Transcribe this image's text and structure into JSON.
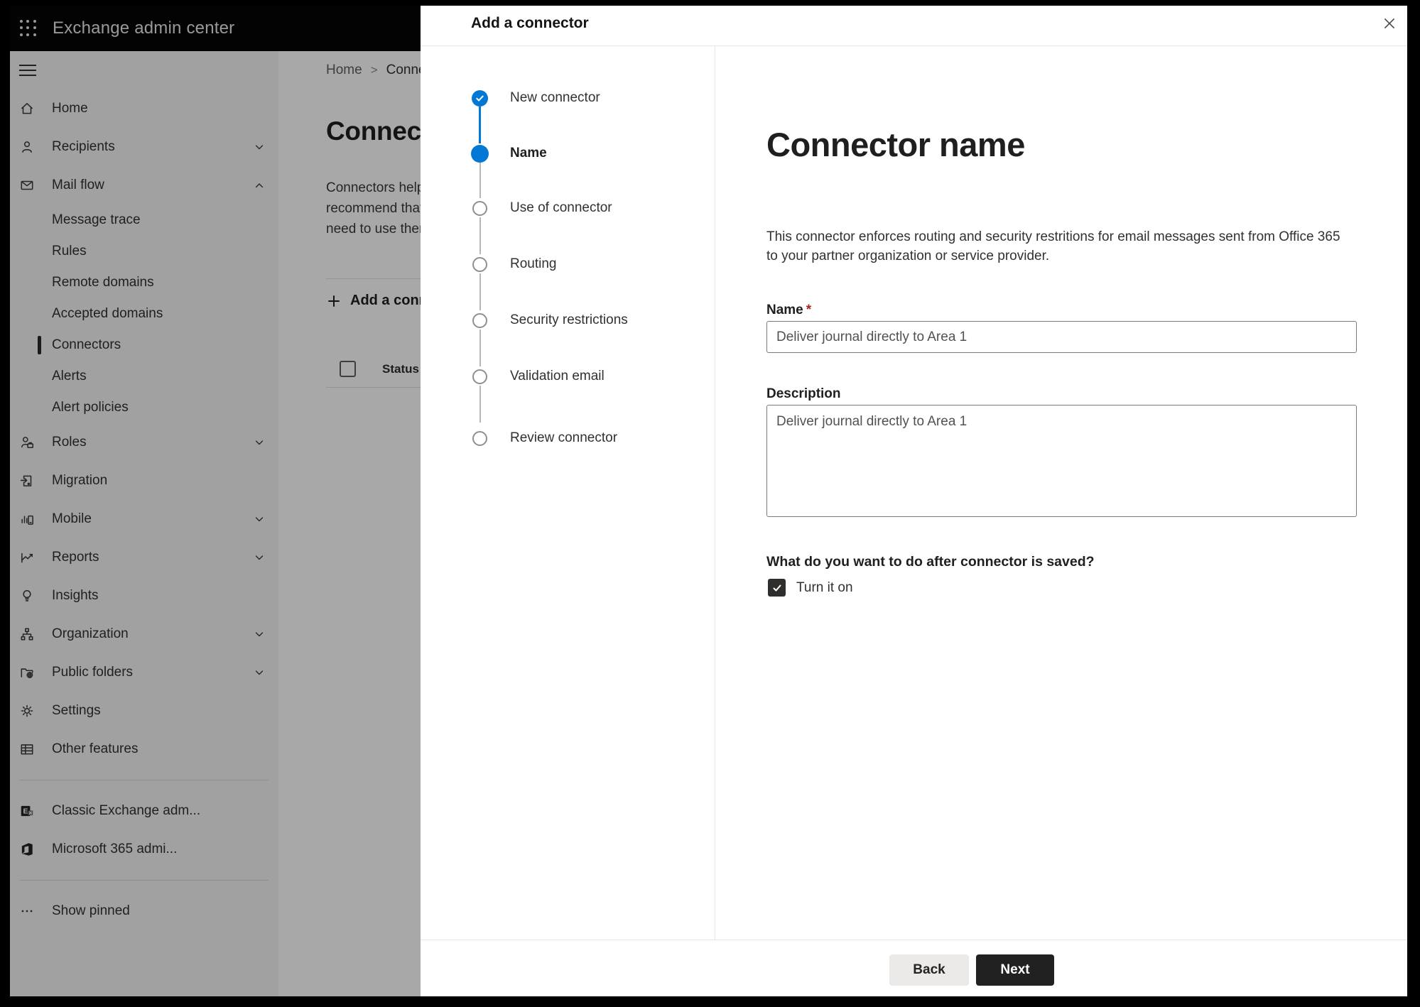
{
  "topbar": {
    "title": "Exchange admin center"
  },
  "sidebar": {
    "items": [
      {
        "label": "Home",
        "icon": "home"
      },
      {
        "label": "Recipients",
        "icon": "person",
        "chevron": "down"
      },
      {
        "label": "Mail flow",
        "icon": "mail",
        "chevron": "up",
        "expanded": true
      },
      {
        "label": "Message trace",
        "type": "sub"
      },
      {
        "label": "Rules",
        "type": "sub"
      },
      {
        "label": "Remote domains",
        "type": "sub"
      },
      {
        "label": "Accepted domains",
        "type": "sub"
      },
      {
        "label": "Connectors",
        "type": "sub",
        "selected": true
      },
      {
        "label": "Alerts",
        "type": "sub"
      },
      {
        "label": "Alert policies",
        "type": "sub"
      },
      {
        "label": "Roles",
        "icon": "roles",
        "chevron": "down"
      },
      {
        "label": "Migration",
        "icon": "migration"
      },
      {
        "label": "Mobile",
        "icon": "mobile",
        "chevron": "down"
      },
      {
        "label": "Reports",
        "icon": "reports",
        "chevron": "down"
      },
      {
        "label": "Insights",
        "icon": "insights"
      },
      {
        "label": "Organization",
        "icon": "organization",
        "chevron": "down"
      },
      {
        "label": "Public folders",
        "icon": "public-folders",
        "chevron": "down"
      },
      {
        "label": "Settings",
        "icon": "settings"
      },
      {
        "label": "Other features",
        "icon": "other-features"
      },
      {
        "label": "Classic Exchange adm...",
        "icon": "classic-exchange"
      },
      {
        "label": "Microsoft 365 admi...",
        "icon": "m365"
      },
      {
        "label": "Show pinned",
        "icon": "ellipsis"
      }
    ]
  },
  "background_page": {
    "breadcrumb": {
      "home": "Home",
      "separator": ">",
      "current": "Connectors"
    },
    "heading": "Connectors",
    "paragraph_lines": [
      "Connectors help",
      "recommend that",
      "need to use ther"
    ],
    "add_button_label": "Add a connector",
    "table": {
      "status_header": "Status"
    }
  },
  "modal": {
    "title": "Add a connector",
    "steps": [
      {
        "label": "New connector",
        "state": "completed"
      },
      {
        "label": "Name",
        "state": "current"
      },
      {
        "label": "Use of connector",
        "state": "upcoming"
      },
      {
        "label": "Routing",
        "state": "upcoming"
      },
      {
        "label": "Security restrictions",
        "state": "upcoming"
      },
      {
        "label": "Validation email",
        "state": "upcoming"
      },
      {
        "label": "Review connector",
        "state": "upcoming"
      }
    ],
    "content": {
      "title": "Connector name",
      "description_line1": "This connector enforces routing and security restritions for email messages sent from Office 365",
      "description_line2": "to your partner organization or service provider.",
      "name_label": "Name",
      "required_marker": "*",
      "name_value": "Deliver journal directly to Area 1",
      "description_label": "Description",
      "description_value": "Deliver journal directly to Area 1",
      "after_save_question": "What do you want to do after connector is saved?",
      "turn_on_label": "Turn it on",
      "turn_on_checked": true
    },
    "footer": {
      "back_label": "Back",
      "next_label": "Next"
    }
  },
  "colors": {
    "accent": "#0078d4",
    "topbar_bg": "#050505",
    "next_btn_bg": "#212121",
    "asterisk": "#a4262c"
  }
}
